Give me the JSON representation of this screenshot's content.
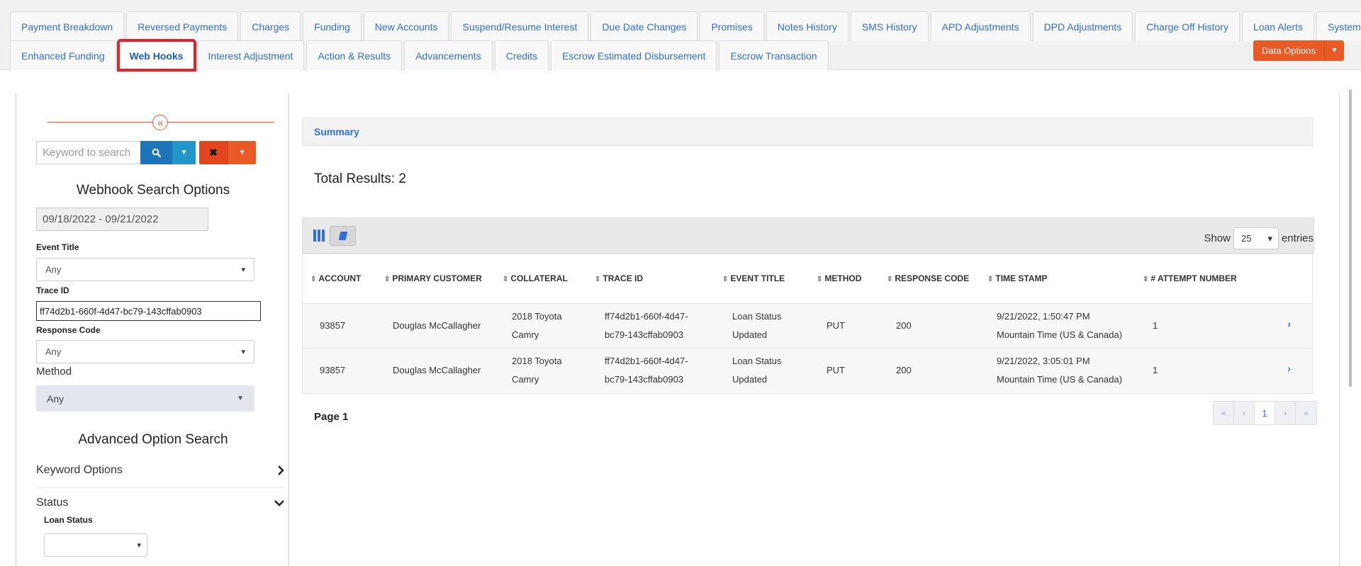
{
  "tabs": {
    "row1": [
      "Payment Breakdown",
      "Reversed Payments",
      "Charges",
      "Funding",
      "New Accounts",
      "Suspend/Resume Interest",
      "Due Date Changes",
      "Promises",
      "Notes History",
      "SMS History",
      "APD Adjustments",
      "DPD Adjustments",
      "Charge Off History",
      "Loan Alerts",
      "System Notes"
    ],
    "row2": [
      "Enhanced Funding",
      "Web Hooks",
      "Interest Adjustment",
      "Action & Results",
      "Advancements",
      "Credits",
      "Escrow Estimated Disbursement",
      "Escrow Transaction"
    ],
    "active": "Web Hooks"
  },
  "data_options_label": "Data Options",
  "sidebar": {
    "collapse_glyph": "«",
    "search_placeholder": "Keyword to search",
    "heading": "Webhook Search Options",
    "date_range": "09/18/2022 - 09/21/2022",
    "event_title_label": "Event Title",
    "event_title_value": "Any",
    "trace_id_label": "Trace ID",
    "trace_id_value": "ff74d2b1-660f-4d47-bc79-143cffab0903",
    "response_code_label": "Response Code",
    "response_code_value": "Any",
    "method_label": "Method",
    "method_value": "Any",
    "advanced_heading": "Advanced Option Search",
    "keyword_options_label": "Keyword Options",
    "status_label": "Status",
    "loan_status_label": "Loan Status"
  },
  "main": {
    "summary_label": "Summary",
    "total_results": "Total Results: 2",
    "show_label": "Show",
    "show_value": "25",
    "entries_label": "entries",
    "columns": [
      "ACCOUNT",
      "PRIMARY CUSTOMER",
      "COLLATERAL",
      "TRACE ID",
      "EVENT TITLE",
      "METHOD",
      "RESPONSE CODE",
      "TIME STAMP",
      "# ATTEMPT NUMBER"
    ],
    "rows": [
      {
        "account": "93857",
        "customer": "Douglas McCallagher",
        "collateral_1": "2018 Toyota",
        "collateral_2": "Camry",
        "trace_1": "ff74d2b1-660f-4d47-",
        "trace_2": "bc79-143cffab0903",
        "event_1": "Loan Status",
        "event_2": "Updated",
        "method": "PUT",
        "response": "200",
        "time_1": "9/21/2022, 1:50:47 PM",
        "time_2": "Mountain Time (US & Canada)",
        "attempt": "1"
      },
      {
        "account": "93857",
        "customer": "Douglas McCallagher",
        "collateral_1": "2018 Toyota",
        "collateral_2": "Camry",
        "trace_1": "ff74d2b1-660f-4d47-",
        "trace_2": "bc79-143cffab0903",
        "event_1": "Loan Status",
        "event_2": "Updated",
        "method": "PUT",
        "response": "200",
        "time_1": "9/21/2022, 3:05:01 PM",
        "time_2": "Mountain Time (US & Canada)",
        "attempt": "1"
      }
    ],
    "page_label": "Page 1",
    "pager": [
      "«",
      "‹",
      "1",
      "›",
      "»"
    ]
  },
  "colors": {
    "accent": "#2f6fd6",
    "orange": "#e85a26",
    "highlight": "#e0242e"
  }
}
